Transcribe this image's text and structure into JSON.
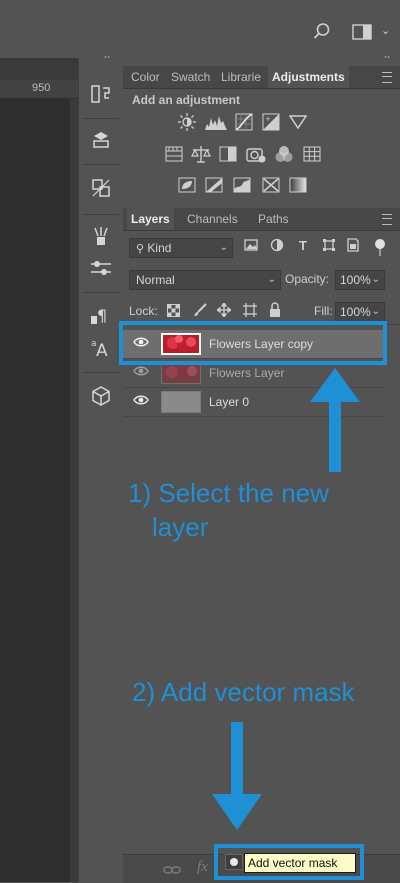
{
  "ruler": {
    "tick_label": "950"
  },
  "panel_tabs_top": [
    "Color",
    "Swatch",
    "Librarie",
    "Adjustments"
  ],
  "adjustments": {
    "header": "Add an adjustment"
  },
  "panel_tabs_layers": [
    "Layers",
    "Channels",
    "Paths"
  ],
  "layers_controls": {
    "filter_kind": "Kind",
    "blend_mode": "Normal",
    "opacity_label": "Opacity:",
    "opacity_value": "100%",
    "lock_label": "Lock:",
    "fill_label": "Fill:",
    "fill_value": "100%"
  },
  "layers": [
    {
      "name": "Flowers Layer copy",
      "selected": true
    },
    {
      "name": "Flowers Layer",
      "selected": false
    },
    {
      "name": "Layer 0",
      "selected": false
    }
  ],
  "bottom_bar": {
    "fx_label": "fx",
    "tooltip": "Add vector mask"
  },
  "annotations": {
    "step1_line1": "1) Select the new",
    "step1_line2": "layer",
    "step2": "2) Add vector mask"
  },
  "colors": {
    "annotation_blue": "#1f8fd6",
    "panel_bg": "#535353",
    "selected_row": "#6e6e6e",
    "tooltip_bg": "#fdfbc6"
  }
}
